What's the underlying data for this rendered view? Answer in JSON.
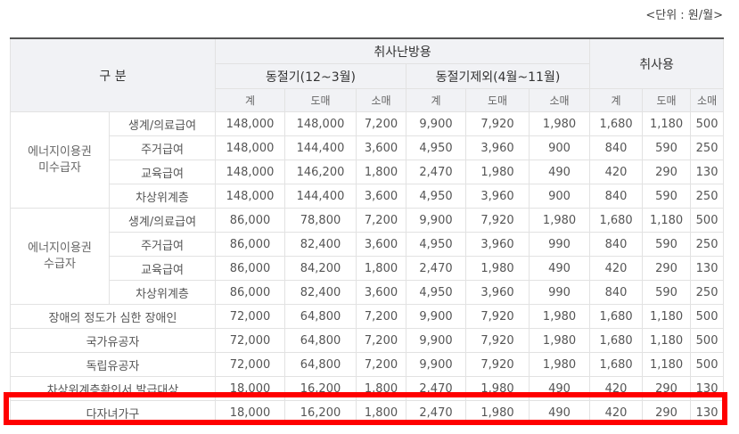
{
  "unit_label": "<단위 : 원/월>",
  "header": {
    "category": "구 분",
    "heating": "취사난방용",
    "winter": "동절기(12~3월)",
    "non_winter": "동절기제외(4월~11월)",
    "cooking": "취사용",
    "sub_cols": [
      "계",
      "도매",
      "소매",
      "계",
      "도매",
      "소매",
      "계",
      "도매",
      "소매"
    ]
  },
  "groups": [
    {
      "name_lines": [
        "에너지이용권",
        "미수급자"
      ],
      "rows": [
        {
          "label": "생계/의료급여",
          "values": [
            "148,000",
            "148,000",
            "7,200",
            "9,900",
            "7,920",
            "1,980",
            "1,680",
            "1,180",
            "500"
          ]
        },
        {
          "label": "주거급여",
          "values": [
            "148,000",
            "144,400",
            "3,600",
            "4,950",
            "3,960",
            "900",
            "840",
            "590",
            "250"
          ]
        },
        {
          "label": "교육급여",
          "values": [
            "148,000",
            "146,200",
            "1,800",
            "2,470",
            "1,980",
            "490",
            "420",
            "290",
            "130"
          ]
        },
        {
          "label": "차상위계층",
          "values": [
            "148,000",
            "144,400",
            "3,600",
            "4,950",
            "3,960",
            "900",
            "840",
            "590",
            "250"
          ]
        }
      ]
    },
    {
      "name_lines": [
        "에너지이용권",
        "수급자"
      ],
      "rows": [
        {
          "label": "생계/의료급여",
          "values": [
            "86,000",
            "78,800",
            "7,200",
            "9,900",
            "7,920",
            "1,980",
            "1,680",
            "1,180",
            "500"
          ]
        },
        {
          "label": "주거급여",
          "values": [
            "86,000",
            "82,400",
            "3,600",
            "4,950",
            "3,960",
            "990",
            "840",
            "590",
            "250"
          ]
        },
        {
          "label": "교육급여",
          "values": [
            "86,000",
            "84,200",
            "1,800",
            "2,470",
            "1,980",
            "490",
            "420",
            "290",
            "130"
          ]
        },
        {
          "label": "차상위계층",
          "values": [
            "86,000",
            "82,400",
            "3,600",
            "4,950",
            "3,960",
            "990",
            "840",
            "590",
            "250"
          ]
        }
      ]
    }
  ],
  "single_rows": [
    {
      "label": "장애의 정도가 심한 장애인",
      "values": [
        "72,000",
        "64,800",
        "7,200",
        "9,900",
        "7,920",
        "1,980",
        "1,680",
        "1,180",
        "500"
      ]
    },
    {
      "label": "국가유공자",
      "values": [
        "72,000",
        "64,800",
        "7,200",
        "9,900",
        "7,920",
        "1,980",
        "1,680",
        "1,180",
        "500"
      ]
    },
    {
      "label": "독립유공자",
      "values": [
        "72,000",
        "64,800",
        "7,200",
        "9,900",
        "7,920",
        "1,980",
        "1,680",
        "1,180",
        "500"
      ]
    },
    {
      "label": "차상위계층확인서 발급대상",
      "values": [
        "18,000",
        "16,200",
        "1,800",
        "2,470",
        "1,980",
        "490",
        "420",
        "290",
        "130"
      ]
    },
    {
      "label": "다자녀가구",
      "values": [
        "18,000",
        "16,200",
        "1,800",
        "2,470",
        "1,980",
        "490",
        "420",
        "290",
        "130"
      ]
    }
  ],
  "highlight": {
    "color": "#ff0000",
    "target": "다자녀가구"
  }
}
